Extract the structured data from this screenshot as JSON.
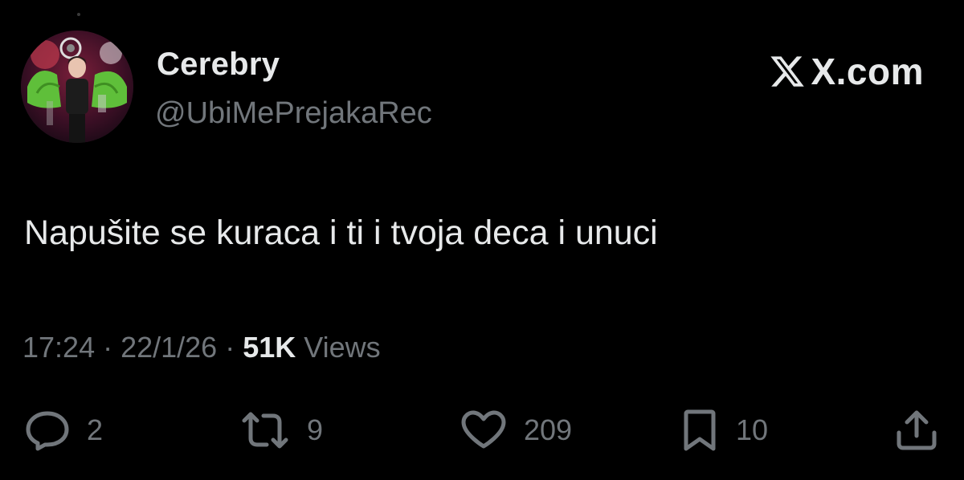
{
  "author": {
    "display_name": "Cerebry",
    "handle": "@UbiMePrejakaRec",
    "avatar_icon": "performer-avatar"
  },
  "brand": {
    "text": "X.com",
    "icon": "x-logo-icon"
  },
  "tweet": {
    "text": "Napušite se kuraca i ti i tvoja deca i unuci"
  },
  "meta": {
    "time": "17:24",
    "separator": " · ",
    "date": "22/1/26",
    "views_count": "51K",
    "views_label": " Views"
  },
  "actions": {
    "replies": {
      "icon": "reply-icon",
      "count": "2"
    },
    "reposts": {
      "icon": "repost-icon",
      "count": "9"
    },
    "likes": {
      "icon": "heart-icon",
      "count": "209"
    },
    "bookmarks": {
      "icon": "bookmark-icon",
      "count": "10"
    },
    "share": {
      "icon": "share-icon"
    }
  },
  "colors": {
    "background": "#000000",
    "primary_text": "#e7e9ea",
    "secondary_text": "#71767b"
  }
}
